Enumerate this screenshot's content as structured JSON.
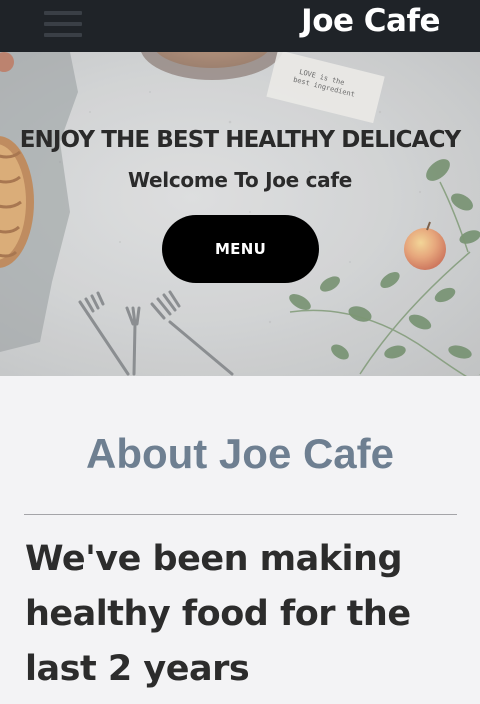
{
  "header": {
    "brand": "Joe Cafe",
    "menu_icon": "hamburger-menu-icon"
  },
  "hero": {
    "title": "ENJOY THE BEST HEALTHY DELICACY",
    "subtitle": "Welcome To Joe cafe",
    "menu_button_label": "MENU",
    "paper_note_text": "LOVE is the best ingredient"
  },
  "about": {
    "heading": "About Joe Cafe",
    "text": "We've been making healthy food for the last 2 years"
  },
  "colors": {
    "header_bg": "#1f2328",
    "button_bg": "#000000",
    "about_heading": "#6e7f91",
    "page_bg": "#f3f3f5"
  }
}
